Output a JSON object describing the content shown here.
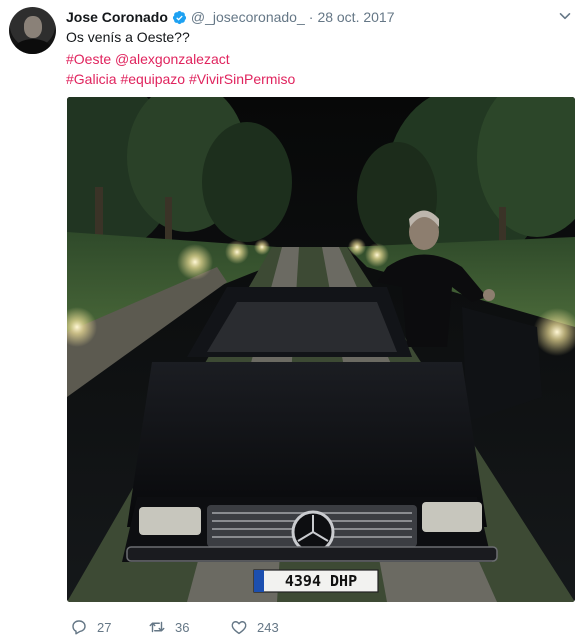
{
  "tweet": {
    "author_name": "Jose Coronado",
    "handle": "@_josecoronado_",
    "separator": "·",
    "date": "28 oct. 2017",
    "text_line1": "Os venís a Oeste??",
    "mentions_line": [
      "#Oeste",
      "@alexgonzalezact"
    ],
    "hashtags_line": [
      "#Galicia",
      "#equipazo",
      "#VivirSinPermiso"
    ],
    "license_plate": "4394 DHP"
  },
  "actions": {
    "reply_count": "27",
    "retweet_count": "36",
    "like_count": "243"
  },
  "icons": {
    "verified": "verified-badge-icon",
    "caret": "chevron-down-icon",
    "reply": "reply-icon",
    "retweet": "retweet-icon",
    "like": "heart-icon"
  },
  "colors": {
    "link": "#e0245e",
    "meta": "#657786",
    "verified": "#1da1f2"
  }
}
